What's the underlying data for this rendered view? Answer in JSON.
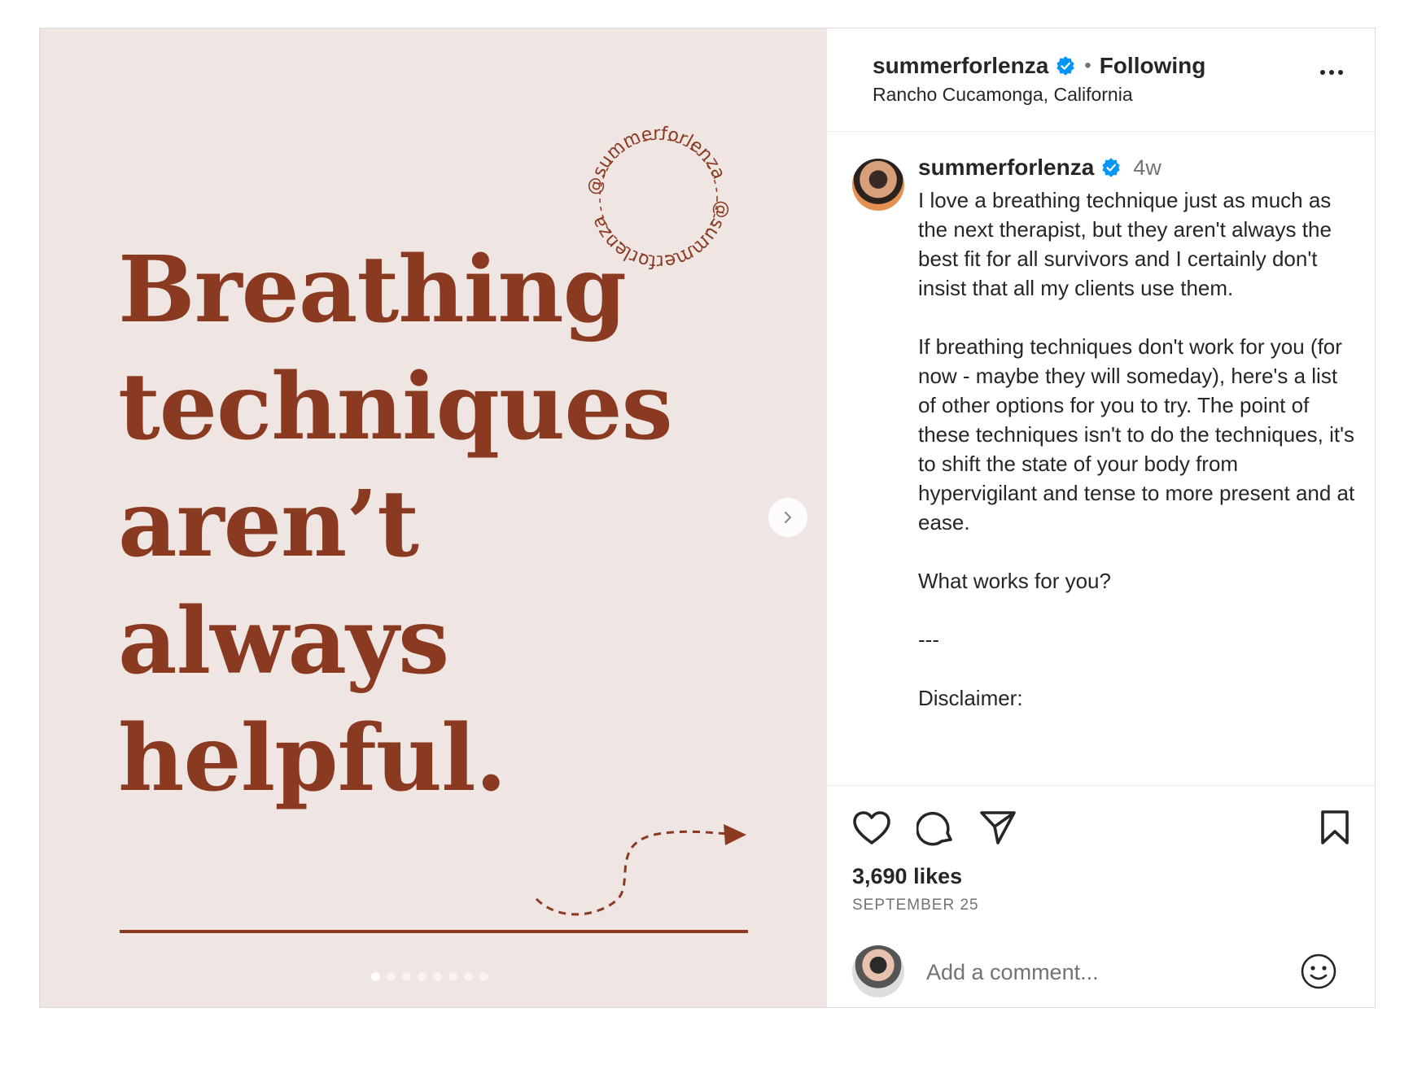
{
  "post": {
    "slide": {
      "headline_lines": [
        "Breathing",
        "techniques",
        "aren’t",
        "always",
        "helpful."
      ],
      "ring_text": "@summerforlenza",
      "brand_color": "#8b3a22",
      "background_color": "#efe5e2",
      "slide_count": 8,
      "active_slide": 1
    },
    "header": {
      "username": "summerforlenza",
      "separator": "•",
      "follow_status": "Following",
      "location": "Rancho Cucamonga, California"
    },
    "caption": {
      "username": "summerforlenza",
      "time": "4w",
      "text": "I love a breathing technique just as much as the next therapist, but they aren't always the best fit for all survivors and I certainly don't insist that all my clients use them.\n\nIf breathing techniques don't work for you (for now - maybe they will someday), here's a list of other options for you to try. The point of these techniques isn't to do the techniques, it's to shift the state of your body from hypervigilant and tense to more present and at ease.\n\nWhat works for you?\n\n---\n\nDisclaimer:"
    },
    "stats": {
      "likes": "3,690 likes",
      "date": "SEPTEMBER 25"
    },
    "comment": {
      "placeholder": "Add a comment..."
    },
    "icons": {
      "like": "heart-icon",
      "comment": "comment-icon",
      "share": "share-icon",
      "save": "bookmark-icon",
      "verified": "verified-badge-icon",
      "more": "more-options-icon",
      "next": "chevron-right-icon",
      "emoji": "emoji-icon"
    },
    "colors": {
      "verified": "#0095f6",
      "text": "#262626",
      "secondary": "#737373"
    }
  }
}
